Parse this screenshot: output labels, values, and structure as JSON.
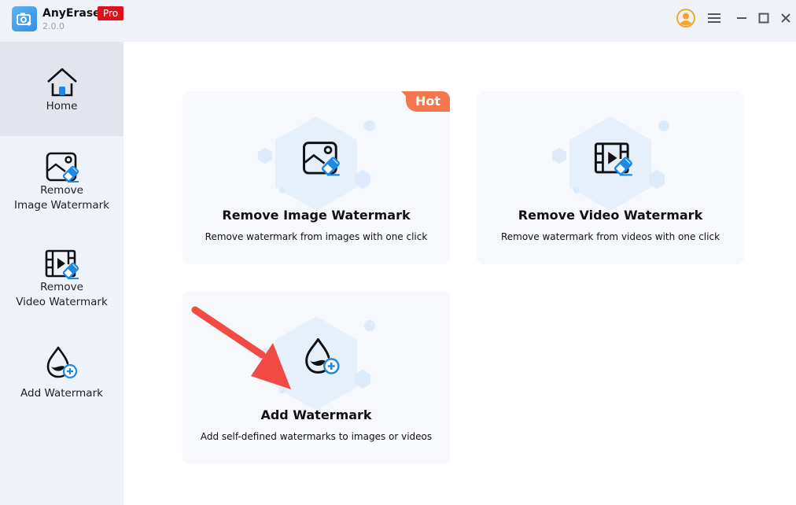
{
  "app": {
    "name": "AnyErase",
    "version": "2.0.0",
    "badge": "Pro"
  },
  "titlebar": {
    "buttons": [
      {
        "icon": "user-avatar-icon"
      },
      {
        "icon": "menu-icon"
      },
      {
        "icon": "minimize-icon"
      },
      {
        "icon": "maximize-icon"
      },
      {
        "icon": "close-icon"
      }
    ]
  },
  "sidebar": {
    "items": [
      {
        "label": "Home",
        "icon": "home-icon",
        "active": true
      },
      {
        "label": "Remove\nImage Watermark",
        "line1": "Remove",
        "line2": "Image Watermark",
        "icon": "image-eraser-icon"
      },
      {
        "label": "Remove\nVideo Watermark",
        "line1": "Remove",
        "line2": "Video Watermark",
        "icon": "video-eraser-icon"
      },
      {
        "label": "Add Watermark",
        "icon": "droplet-plus-icon"
      }
    ]
  },
  "cards": [
    {
      "title": "Remove Image Watermark",
      "description": "Remove watermark from images with one click",
      "badge": "Hot",
      "icon": "image-eraser-icon"
    },
    {
      "title": "Remove Video Watermark",
      "description": "Remove watermark from videos with one click",
      "icon": "video-eraser-icon"
    },
    {
      "title": "Add Watermark",
      "description": "Add self-defined watermarks to images or videos",
      "icon": "droplet-plus-icon"
    }
  ],
  "colors": {
    "accent": "#1e88e5",
    "pro_badge": "#e0101b",
    "hot_badge": "#f5764f",
    "avatar": "#f8a32a",
    "annotation_arrow": "#f24a45"
  }
}
